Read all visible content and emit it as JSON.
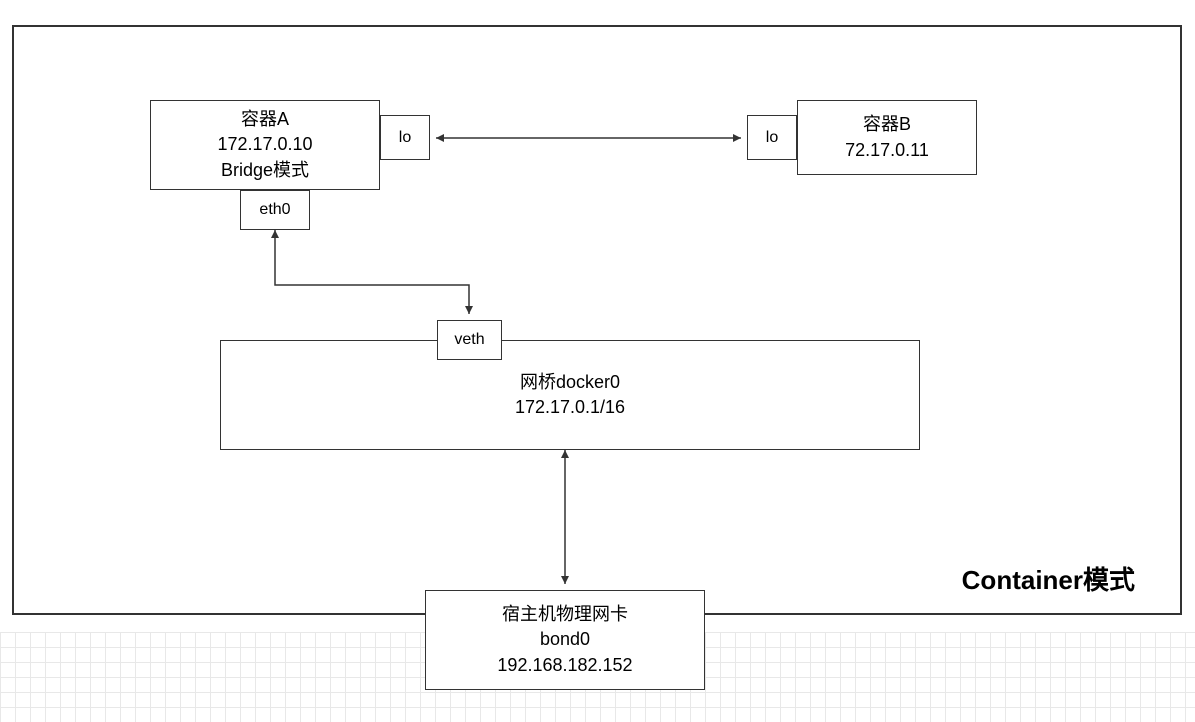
{
  "mode_title": "Container模式",
  "container_a": {
    "name": "容器A",
    "ip": "172.17.0.10",
    "mode": "Bridge模式",
    "lo": "lo",
    "eth0": "eth0"
  },
  "container_b": {
    "name": "容器B",
    "ip": "72.17.0.11",
    "lo": "lo"
  },
  "bridge": {
    "veth": "veth",
    "name": "网桥docker0",
    "cidr": "172.17.0.1/16"
  },
  "host_nic": {
    "desc": "宿主机物理网卡",
    "dev": "bond0",
    "ip": "192.168.182.152"
  }
}
